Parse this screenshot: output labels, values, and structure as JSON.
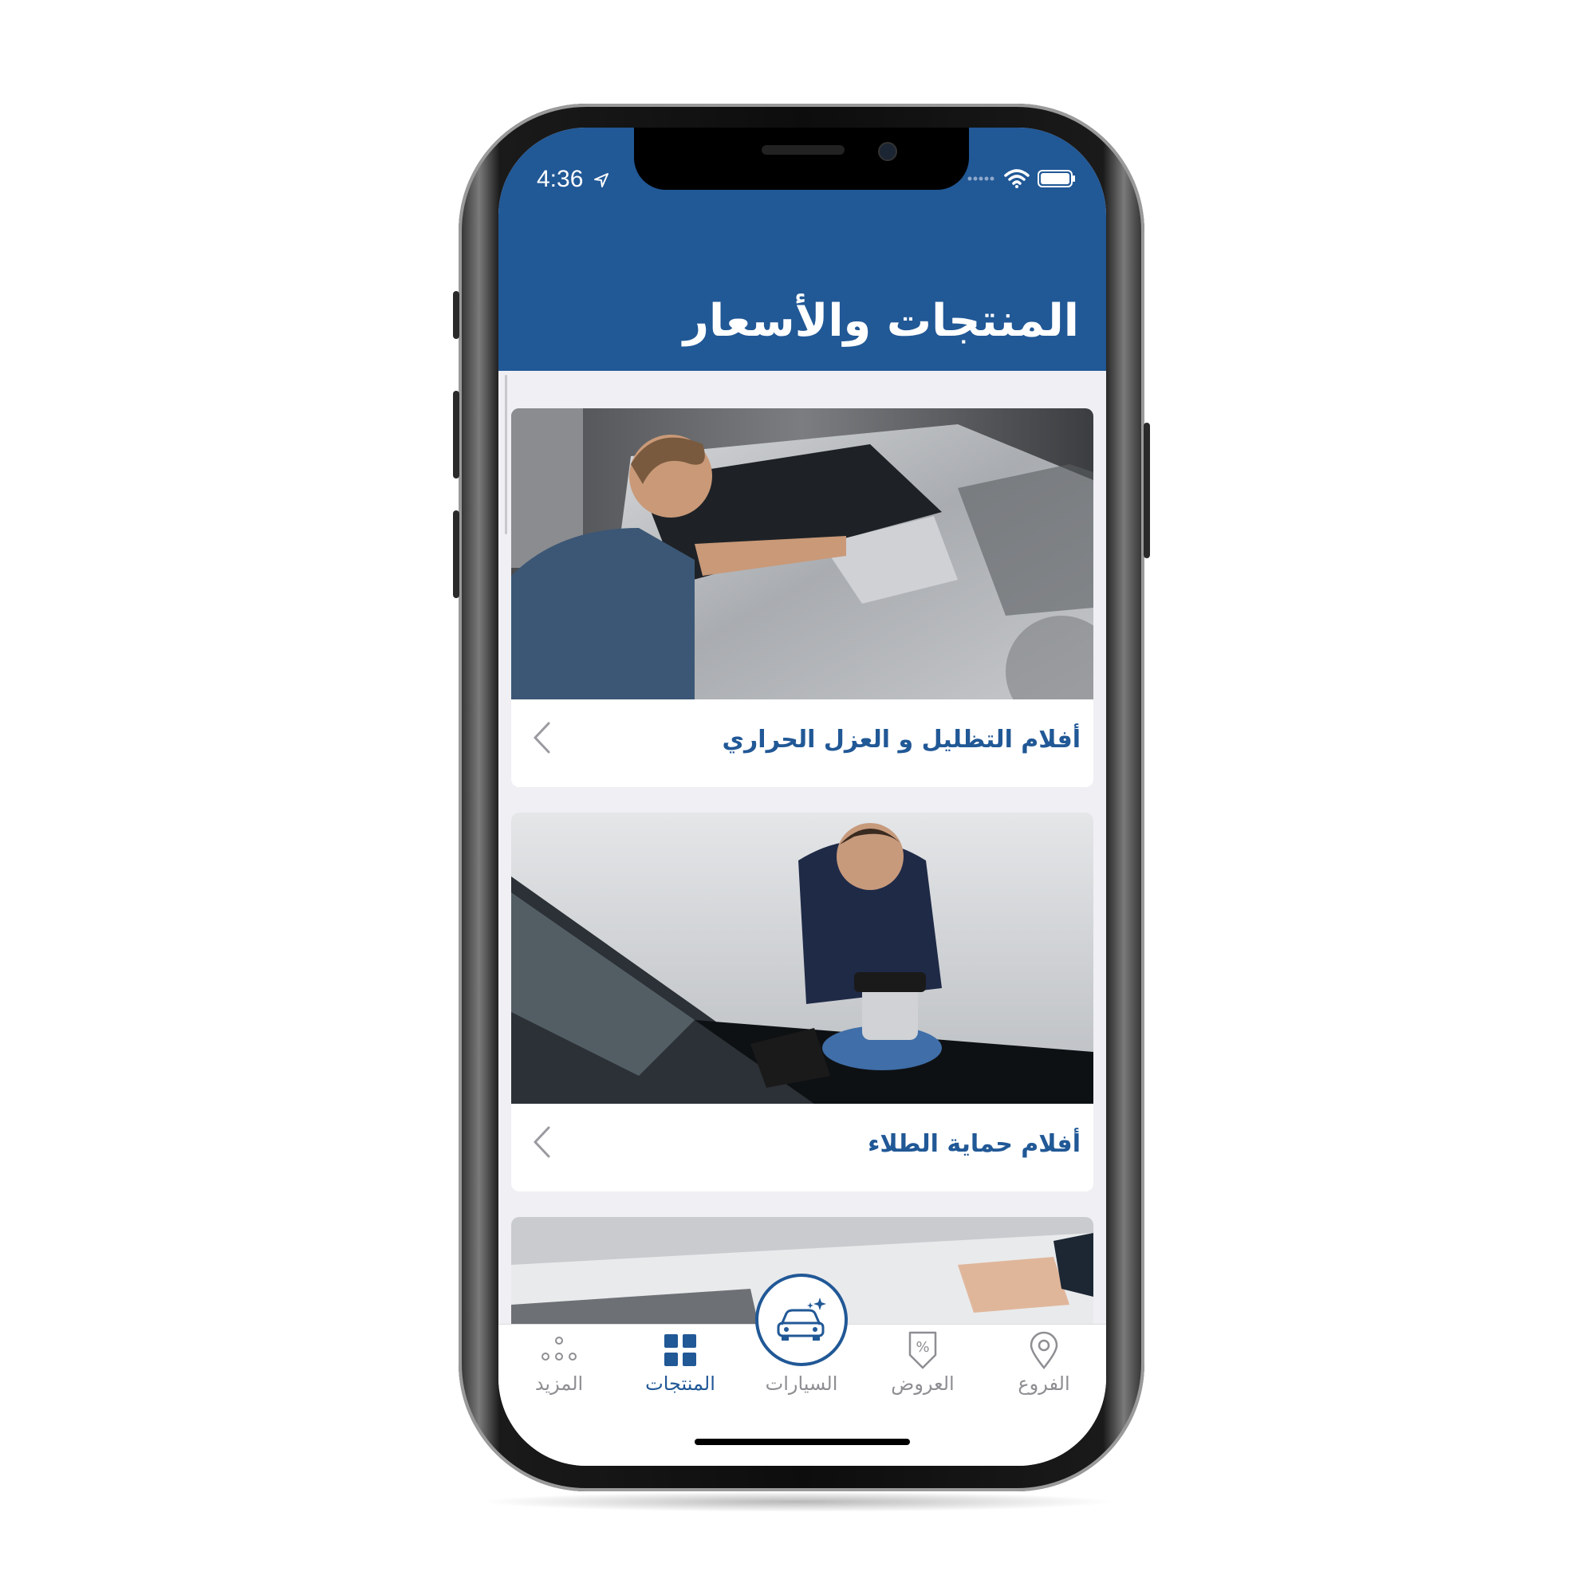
{
  "status_bar": {
    "time": "4:36"
  },
  "header": {
    "title": "المنتجات والأسعار"
  },
  "cards": [
    {
      "label": "أفلام التظليل و العزل الحراري"
    },
    {
      "label": "أفلام حماية الطلاء"
    }
  ],
  "tabbar": {
    "more": "المزيد",
    "products": "المنتجات",
    "cars": "السيارات",
    "offers": "العروض",
    "branches": "الفروع"
  },
  "colors": {
    "brand": "#215896",
    "inactive": "#8e8e93"
  }
}
